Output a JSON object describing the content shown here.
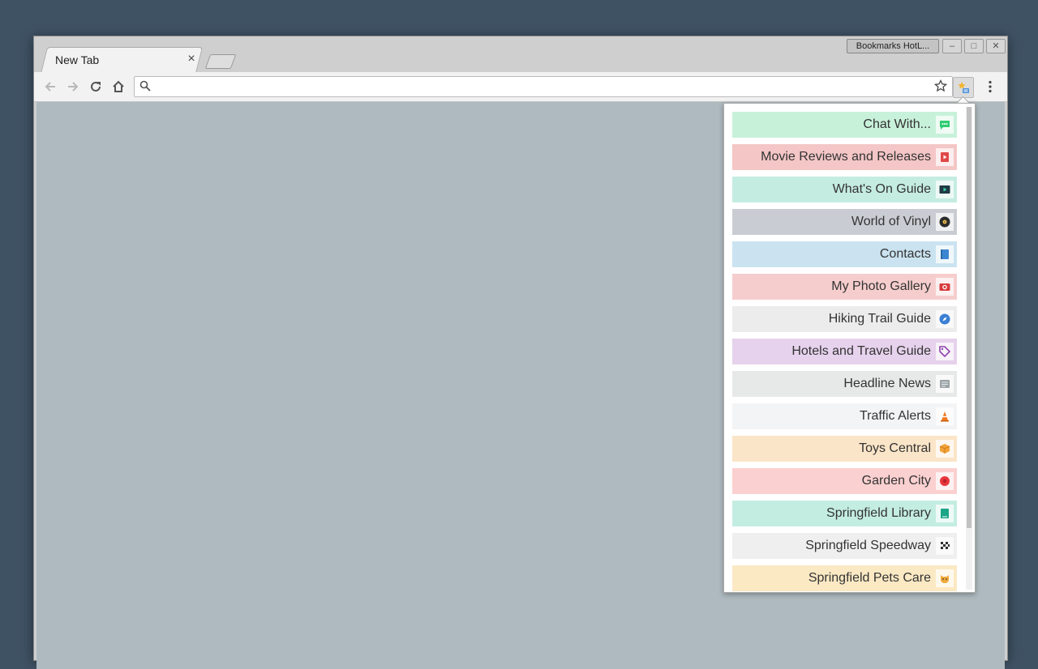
{
  "browser": {
    "tab_title": "New Tab",
    "tab_close": "×",
    "extension_title": "Bookmarks HotL...",
    "omnibox_value": "",
    "window_controls": {
      "minimize": "–",
      "maximize": "□",
      "close": "✕"
    }
  },
  "popup": {
    "items": [
      {
        "label": "Chat With...",
        "icon": "chat-icon",
        "color": "#c8f1da"
      },
      {
        "label": "Movie Reviews and Releases",
        "icon": "film-icon",
        "color": "#f4c6c6"
      },
      {
        "label": "What's On Guide",
        "icon": "tv-play-icon",
        "color": "#c5ece1"
      },
      {
        "label": "World of Vinyl",
        "icon": "vinyl-record-icon",
        "color": "#c9cdd3"
      },
      {
        "label": "Contacts",
        "icon": "address-book-icon",
        "color": "#cbe3f0"
      },
      {
        "label": "My Photo Gallery",
        "icon": "camera-icon",
        "color": "#f6cdcd"
      },
      {
        "label": "Hiking Trail Guide",
        "icon": "compass-icon",
        "color": "#ececec"
      },
      {
        "label": "Hotels and Travel Guide",
        "icon": "tag-icon",
        "color": "#e6d2ec"
      },
      {
        "label": "Headline News",
        "icon": "newspaper-icon",
        "color": "#e6e9e8"
      },
      {
        "label": "Traffic Alerts",
        "icon": "traffic-cone-icon",
        "color": "#f3f4f5"
      },
      {
        "label": "Toys Central",
        "icon": "toy-box-icon",
        "color": "#fbe5c8"
      },
      {
        "label": "Garden City",
        "icon": "flower-icon",
        "color": "#fbd0d0"
      },
      {
        "label": "Springfield Library",
        "icon": "book-icon",
        "color": "#c4ede1"
      },
      {
        "label": "Springfield Speedway",
        "icon": "checkered-flag-icon",
        "color": "#efefef"
      },
      {
        "label": "Springfield Pets Care",
        "icon": "cat-icon",
        "color": "#fbe9c4"
      }
    ]
  }
}
